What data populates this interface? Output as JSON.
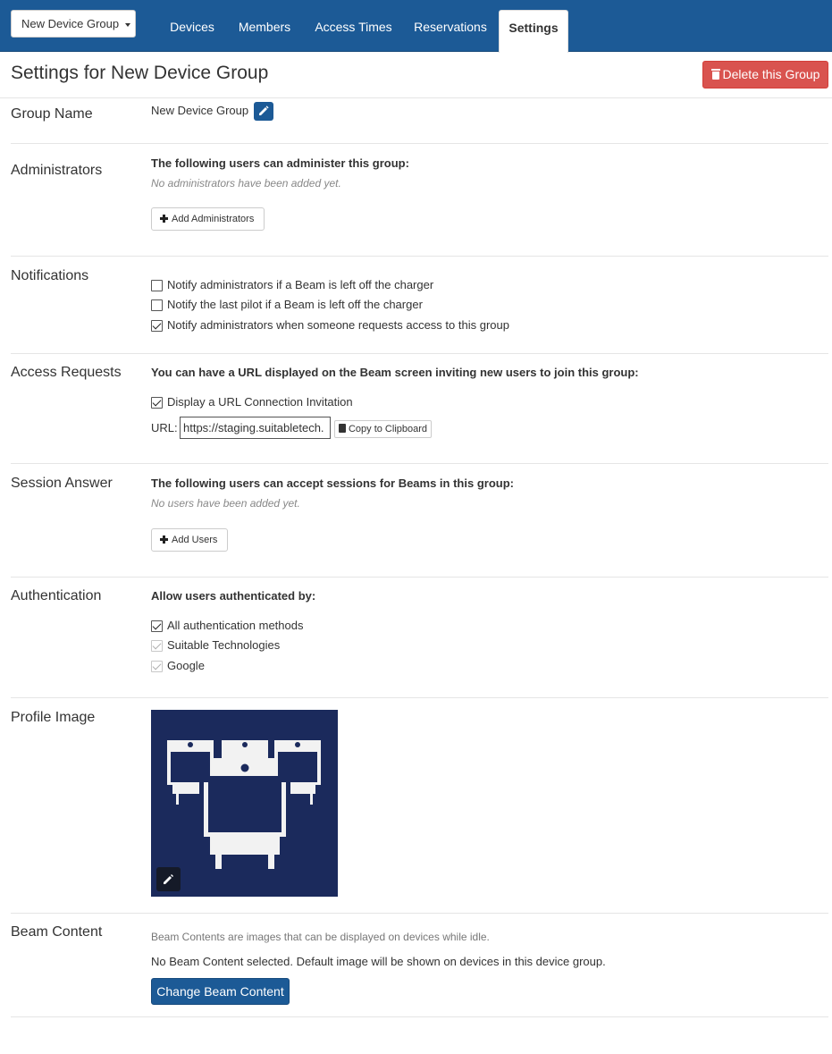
{
  "header": {
    "group_dropdown": "New Device Group",
    "tabs": [
      {
        "label": "Devices"
      },
      {
        "label": "Members"
      },
      {
        "label": "Access Times"
      },
      {
        "label": "Reservations"
      },
      {
        "label": "Settings",
        "active": true
      }
    ]
  },
  "page": {
    "title": "Settings for New Device Group",
    "delete_button": "Delete this Group"
  },
  "group_name": {
    "label": "Group Name",
    "value": "New Device Group"
  },
  "administrators": {
    "label": "Administrators",
    "heading": "The following users can administer this group:",
    "empty": "No administrators have been added yet.",
    "add_button": "Add Administrators"
  },
  "notifications": {
    "label": "Notifications",
    "items": [
      {
        "label": "Notify administrators if a Beam is left off the charger",
        "checked": false
      },
      {
        "label": "Notify the last pilot if a Beam is left off the charger",
        "checked": false
      },
      {
        "label": "Notify administrators when someone requests access to this group",
        "checked": true
      }
    ]
  },
  "access_requests": {
    "label": "Access Requests",
    "heading": "You can have a URL displayed on the Beam screen inviting new users to join this group:",
    "display_url": {
      "label": "Display a URL Connection Invitation",
      "checked": true
    },
    "url_label": "URL:",
    "url_value": "https://staging.suitabletech.",
    "copy_button": "Copy to Clipboard"
  },
  "session_answer": {
    "label": "Session Answer",
    "heading": "The following users can accept sessions for Beams in this group:",
    "empty": "No users have been added yet.",
    "add_button": "Add Users"
  },
  "authentication": {
    "label": "Authentication",
    "heading": "Allow users authenticated by:",
    "methods": [
      {
        "label": "All authentication methods",
        "checked": true,
        "disabled": false
      },
      {
        "label": "Suitable Technologies",
        "checked": true,
        "disabled": true
      },
      {
        "label": "Google",
        "checked": true,
        "disabled": true
      }
    ]
  },
  "profile_image": {
    "label": "Profile Image",
    "background_color": "#1b2a5c"
  },
  "beam_content": {
    "label": "Beam Content",
    "description": "Beam Contents are images that can be displayed on devices while idle.",
    "status": "No Beam Content selected. Default image will be shown on devices in this device group.",
    "change_button": "Change Beam Content"
  },
  "colors": {
    "nav": "#1c5a96",
    "danger": "#d9534f",
    "primary": "#1c5a96"
  }
}
